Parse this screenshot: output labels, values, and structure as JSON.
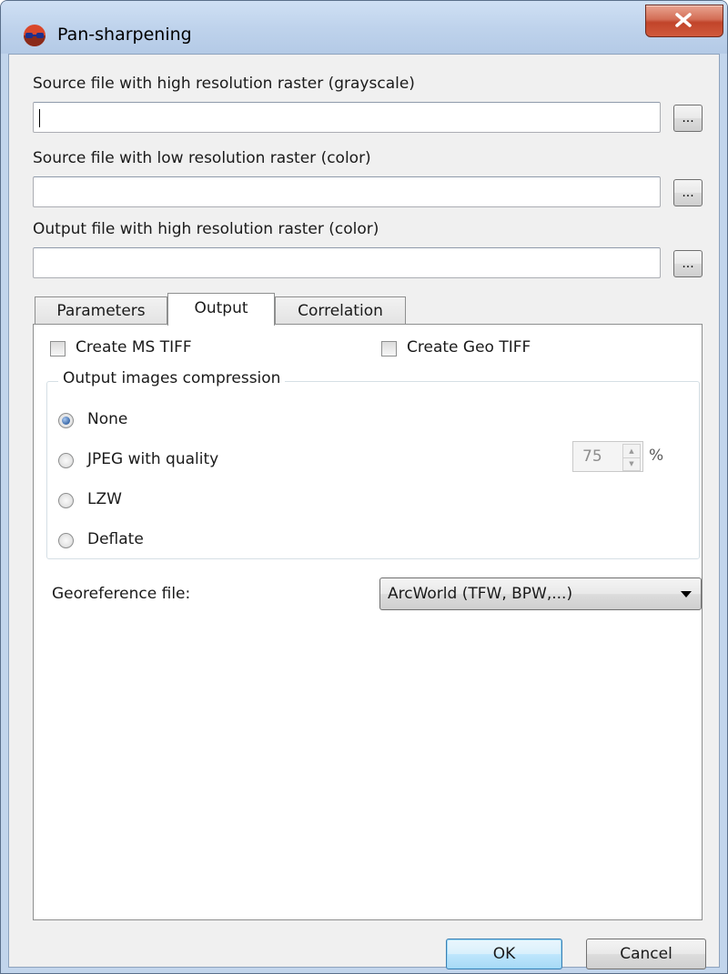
{
  "window": {
    "title": "Pan-sharpening"
  },
  "fields": [
    {
      "label": "Source file with high resolution raster (grayscale)",
      "value": "",
      "browse": "..."
    },
    {
      "label": "Source file with low resolution raster (color)",
      "value": "",
      "browse": "..."
    },
    {
      "label": "Output file with high resolution raster (color)",
      "value": "",
      "browse": "..."
    }
  ],
  "tabs": [
    {
      "label": "Parameters",
      "active": false
    },
    {
      "label": "Output",
      "active": true
    },
    {
      "label": "Correlation",
      "active": false
    }
  ],
  "output": {
    "create_ms_tiff": {
      "label": "Create MS TIFF",
      "checked": false
    },
    "create_geo_tiff": {
      "label": "Create Geo TIFF",
      "checked": false
    },
    "compression": {
      "title": "Output images compression",
      "options": [
        {
          "label": "None",
          "checked": true
        },
        {
          "label": "JPEG with quality",
          "checked": false
        },
        {
          "label": "LZW",
          "checked": false
        },
        {
          "label": "Deflate",
          "checked": false
        }
      ],
      "jpeg_quality": "75",
      "unit": "%"
    },
    "georeference": {
      "label": "Georeference file:",
      "value": "ArcWorld (TFW, BPW,...)"
    }
  },
  "buttons": {
    "ok": "OK",
    "cancel": "Cancel"
  },
  "colors": {
    "titlebar": "#c2d5ec",
    "close": "#c1442a",
    "default_button": "#bee6fd"
  }
}
